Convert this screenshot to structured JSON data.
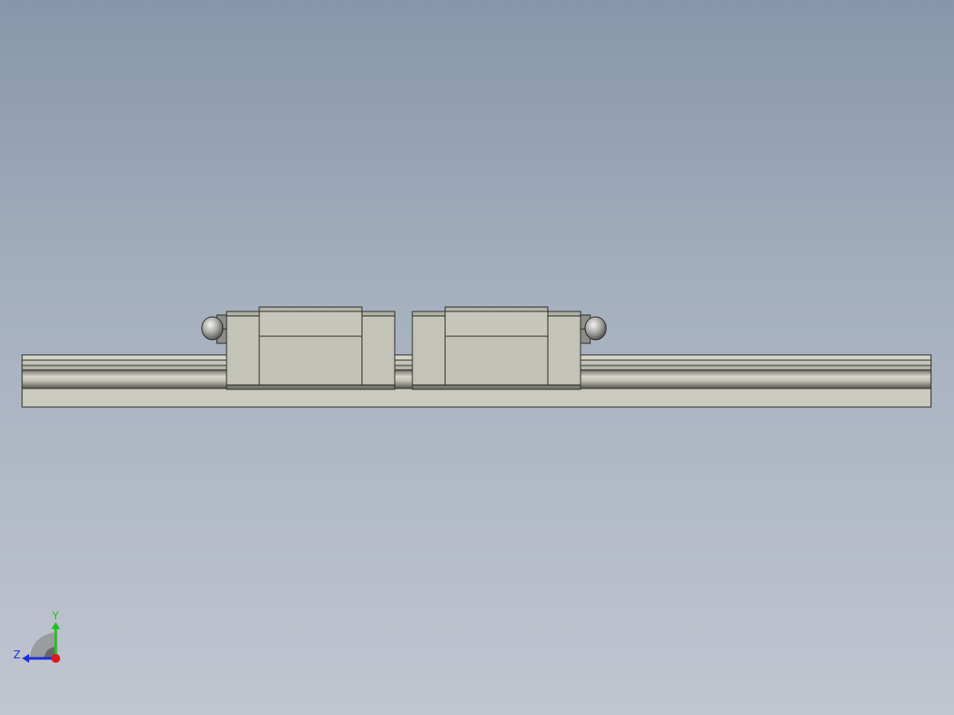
{
  "viewport": {
    "background_top": "#8796aa",
    "background_bottom": "#c1c6d0"
  },
  "model": {
    "description_name": "linear-guide-rail-assembly",
    "rail_color": "#c8c7bb",
    "block_color": "#c3c2b8",
    "edge_color": "#2b2b2b",
    "carriage_count": 2
  },
  "triad": {
    "y_label": "Y",
    "z_label": "Z",
    "y_color": "#21c21e",
    "z_color": "#1b2fd8",
    "x_color": "#e0181b"
  }
}
